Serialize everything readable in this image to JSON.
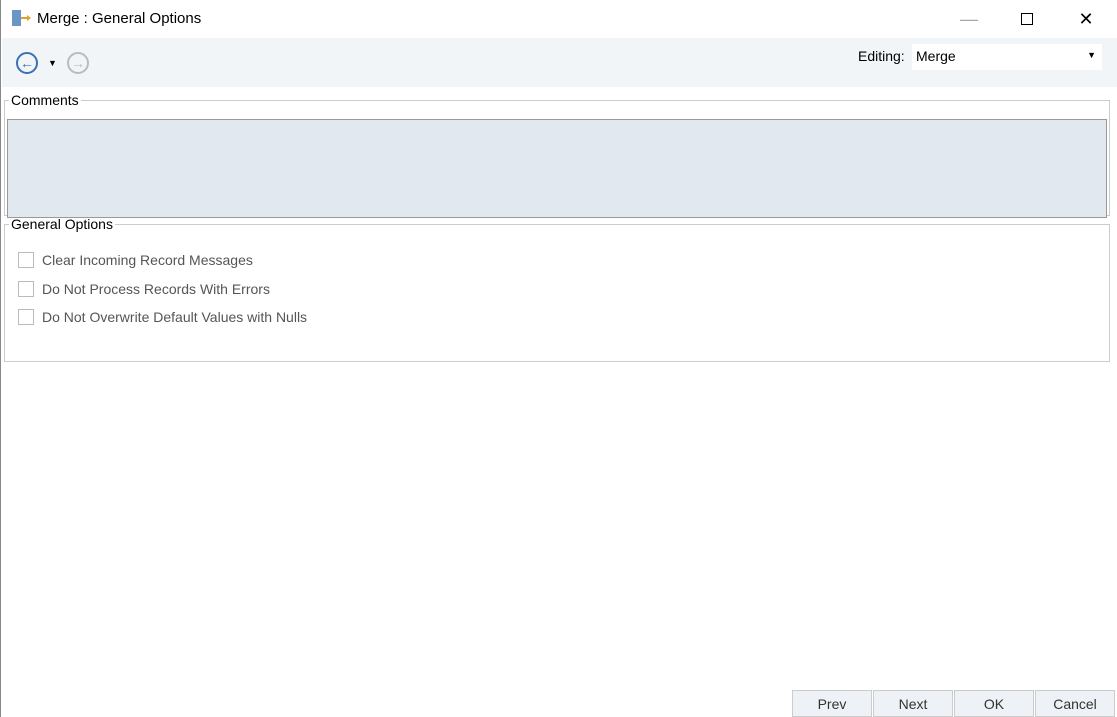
{
  "window": {
    "title": "Merge : General Options",
    "icon": "merge-tool-icon"
  },
  "toolbar": {
    "back_icon": "back-arrow-icon",
    "forward_icon": "forward-arrow-icon",
    "editing_label": "Editing:",
    "editing_value": "Merge"
  },
  "comments": {
    "label": "Comments",
    "value": ""
  },
  "general": {
    "label": "General Options",
    "options": [
      {
        "label": "Clear Incoming Record Messages",
        "checked": false
      },
      {
        "label": "Do Not Process Records With Errors",
        "checked": false
      },
      {
        "label": "Do Not Overwrite Default Values with Nulls",
        "checked": false
      }
    ]
  },
  "buttons": {
    "prev": "Prev",
    "next": "Next",
    "ok": "OK",
    "cancel": "Cancel"
  }
}
